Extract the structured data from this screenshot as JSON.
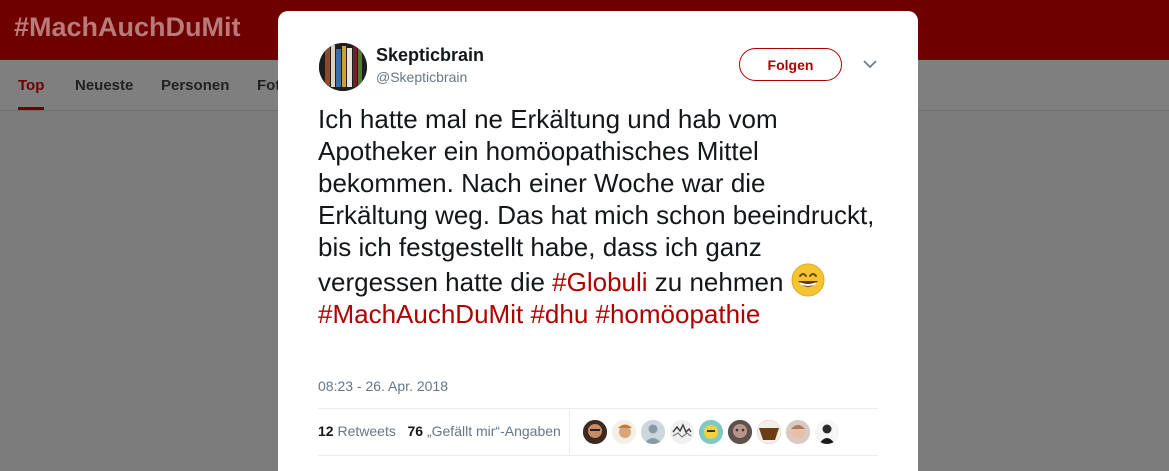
{
  "header": {
    "hashtag_title": "#MachAuchDuMit"
  },
  "tabs": [
    {
      "label": "Top",
      "active": true
    },
    {
      "label": "Neueste"
    },
    {
      "label": "Personen"
    },
    {
      "label": "Fot"
    }
  ],
  "tweet": {
    "display_name": "Skepticbrain",
    "handle": "@Skepticbrain",
    "follow_label": "Folgen",
    "text_part1": "Ich hatte mal ne Erkältung und hab vom Apotheker ein homöopathisches Mittel bekommen. Nach einer Woche war die Erkältung  weg. Das hat mich schon beeindruckt, bis ich festgestellt habe, dass ich ganz vergessen hatte die ",
    "hashtag1": "#Globuli",
    "text_part2": " zu nehmen ",
    "hashtag2": "#MachAuchDuMit",
    "hashtag3": "#dhu",
    "hashtag4": "#homöopathie",
    "timestamp": "08:23 - 26. Apr. 2018",
    "retweets_count": "12",
    "retweets_label": "Retweets",
    "likes_count": "76",
    "likes_label": "„Gefällt mir“-Angaben"
  },
  "colors": {
    "brand_dark_red": "#6e0000",
    "hashtag_red": "#b00000",
    "overlay_gray": "#7c7c7c"
  },
  "icons": [
    "chevron-down-icon",
    "grinning-face-emoji"
  ]
}
